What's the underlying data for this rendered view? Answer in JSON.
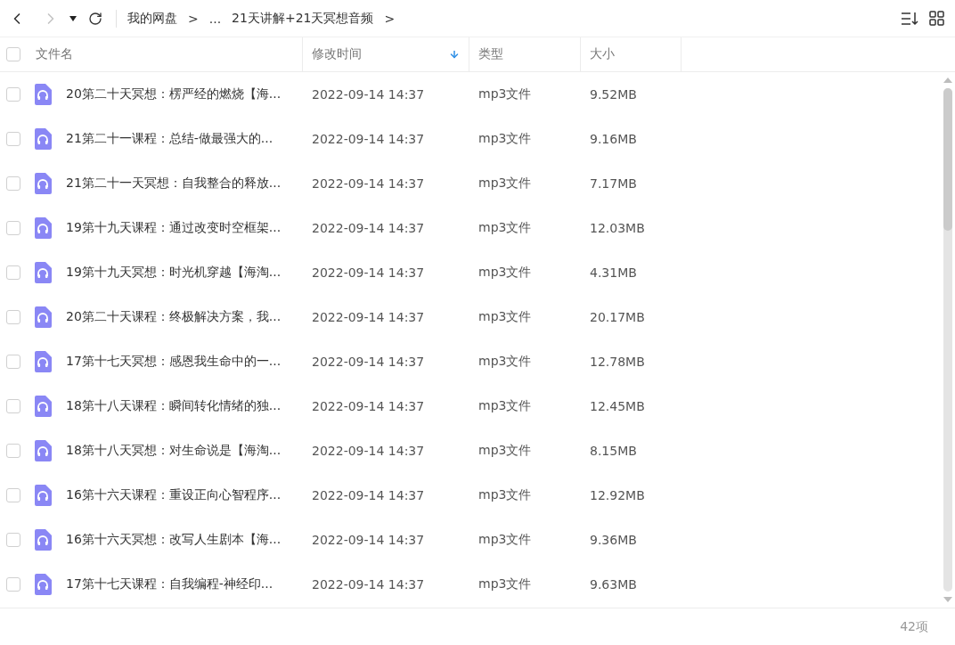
{
  "toolbar": {
    "back_enabled": true,
    "forward_enabled": false,
    "breadcrumb": [
      {
        "label": "我的网盘",
        "separator": ">"
      },
      {
        "label": "..."
      },
      {
        "label": "21天讲解+21天冥想音频",
        "separator": ">"
      }
    ]
  },
  "table": {
    "select_all_checked": false,
    "columns": [
      {
        "label": "文件名",
        "sorted": false
      },
      {
        "label": "修改时间",
        "sorted": true
      },
      {
        "label": "类型",
        "sorted": false
      },
      {
        "label": "大小",
        "sorted": false
      }
    ],
    "rows": [
      {
        "checked": false,
        "name": "20第二十天冥想：楞严经的燃烧【海...",
        "modified": "2022-09-14 14:37",
        "type": "mp3文件",
        "size": "9.52MB"
      },
      {
        "checked": false,
        "name": "21第二十一课程：总结-做最强大的...",
        "modified": "2022-09-14 14:37",
        "type": "mp3文件",
        "size": "9.16MB"
      },
      {
        "checked": false,
        "name": "21第二十一天冥想：自我整合的释放...",
        "modified": "2022-09-14 14:37",
        "type": "mp3文件",
        "size": "7.17MB"
      },
      {
        "checked": false,
        "name": "19第十九天课程：通过改变时空框架...",
        "modified": "2022-09-14 14:37",
        "type": "mp3文件",
        "size": "12.03MB"
      },
      {
        "checked": false,
        "name": "19第十九天冥想：时光机穿越【海淘...",
        "modified": "2022-09-14 14:37",
        "type": "mp3文件",
        "size": "4.31MB"
      },
      {
        "checked": false,
        "name": "20第二十天课程：终极解决方案，我...",
        "modified": "2022-09-14 14:37",
        "type": "mp3文件",
        "size": "20.17MB"
      },
      {
        "checked": false,
        "name": "17第十七天冥想：感恩我生命中的一...",
        "modified": "2022-09-14 14:37",
        "type": "mp3文件",
        "size": "12.78MB"
      },
      {
        "checked": false,
        "name": "18第十八天课程：瞬间转化情绪的独...",
        "modified": "2022-09-14 14:37",
        "type": "mp3文件",
        "size": "12.45MB"
      },
      {
        "checked": false,
        "name": "18第十八天冥想：对生命说是【海淘...",
        "modified": "2022-09-14 14:37",
        "type": "mp3文件",
        "size": "8.15MB"
      },
      {
        "checked": false,
        "name": "16第十六天课程：重设正向心智程序...",
        "modified": "2022-09-14 14:37",
        "type": "mp3文件",
        "size": "12.92MB"
      },
      {
        "checked": false,
        "name": "16第十六天冥想：改写人生剧本【海...",
        "modified": "2022-09-14 14:37",
        "type": "mp3文件",
        "size": "9.36MB"
      },
      {
        "checked": false,
        "name": "17第十七天课程：自我编程-神经印...",
        "modified": "2022-09-14 14:37",
        "type": "mp3文件",
        "size": "9.63MB"
      }
    ]
  },
  "status_bar": {
    "count": "42项"
  }
}
